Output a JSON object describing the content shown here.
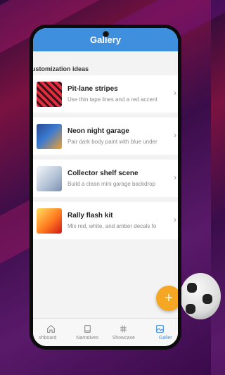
{
  "app": {
    "title": "Gallery"
  },
  "section_title": "ustomization ideas",
  "cards": [
    {
      "title": "Pit-lane stripes",
      "description": "Use thin tape lines and a red accent",
      "thumb_icon": "red-stripes-thumbnail"
    },
    {
      "title": "Neon night garage",
      "description": "Pair dark body paint with blue under",
      "thumb_icon": "neon-garage-thumbnail"
    },
    {
      "title": "Collector shelf scene",
      "description": "Build a clean mini garage backdrop",
      "thumb_icon": "shelf-scene-thumbnail"
    },
    {
      "title": "Rally flash kit",
      "description": "Mix red, white, and amber decals fo",
      "thumb_icon": "rally-kit-thumbnail"
    }
  ],
  "fab": {
    "label": "+"
  },
  "bottom_nav": [
    {
      "label": "shboard",
      "icon": "home-icon"
    },
    {
      "label": "Narratives",
      "icon": "book-icon"
    },
    {
      "label": "Showcase",
      "icon": "hash-icon"
    },
    {
      "label": "Galler",
      "icon": "image-icon",
      "active": true
    }
  ],
  "colors": {
    "primary": "#3f8fdf",
    "accent": "#f5a623",
    "background": "#f3f3f3"
  }
}
